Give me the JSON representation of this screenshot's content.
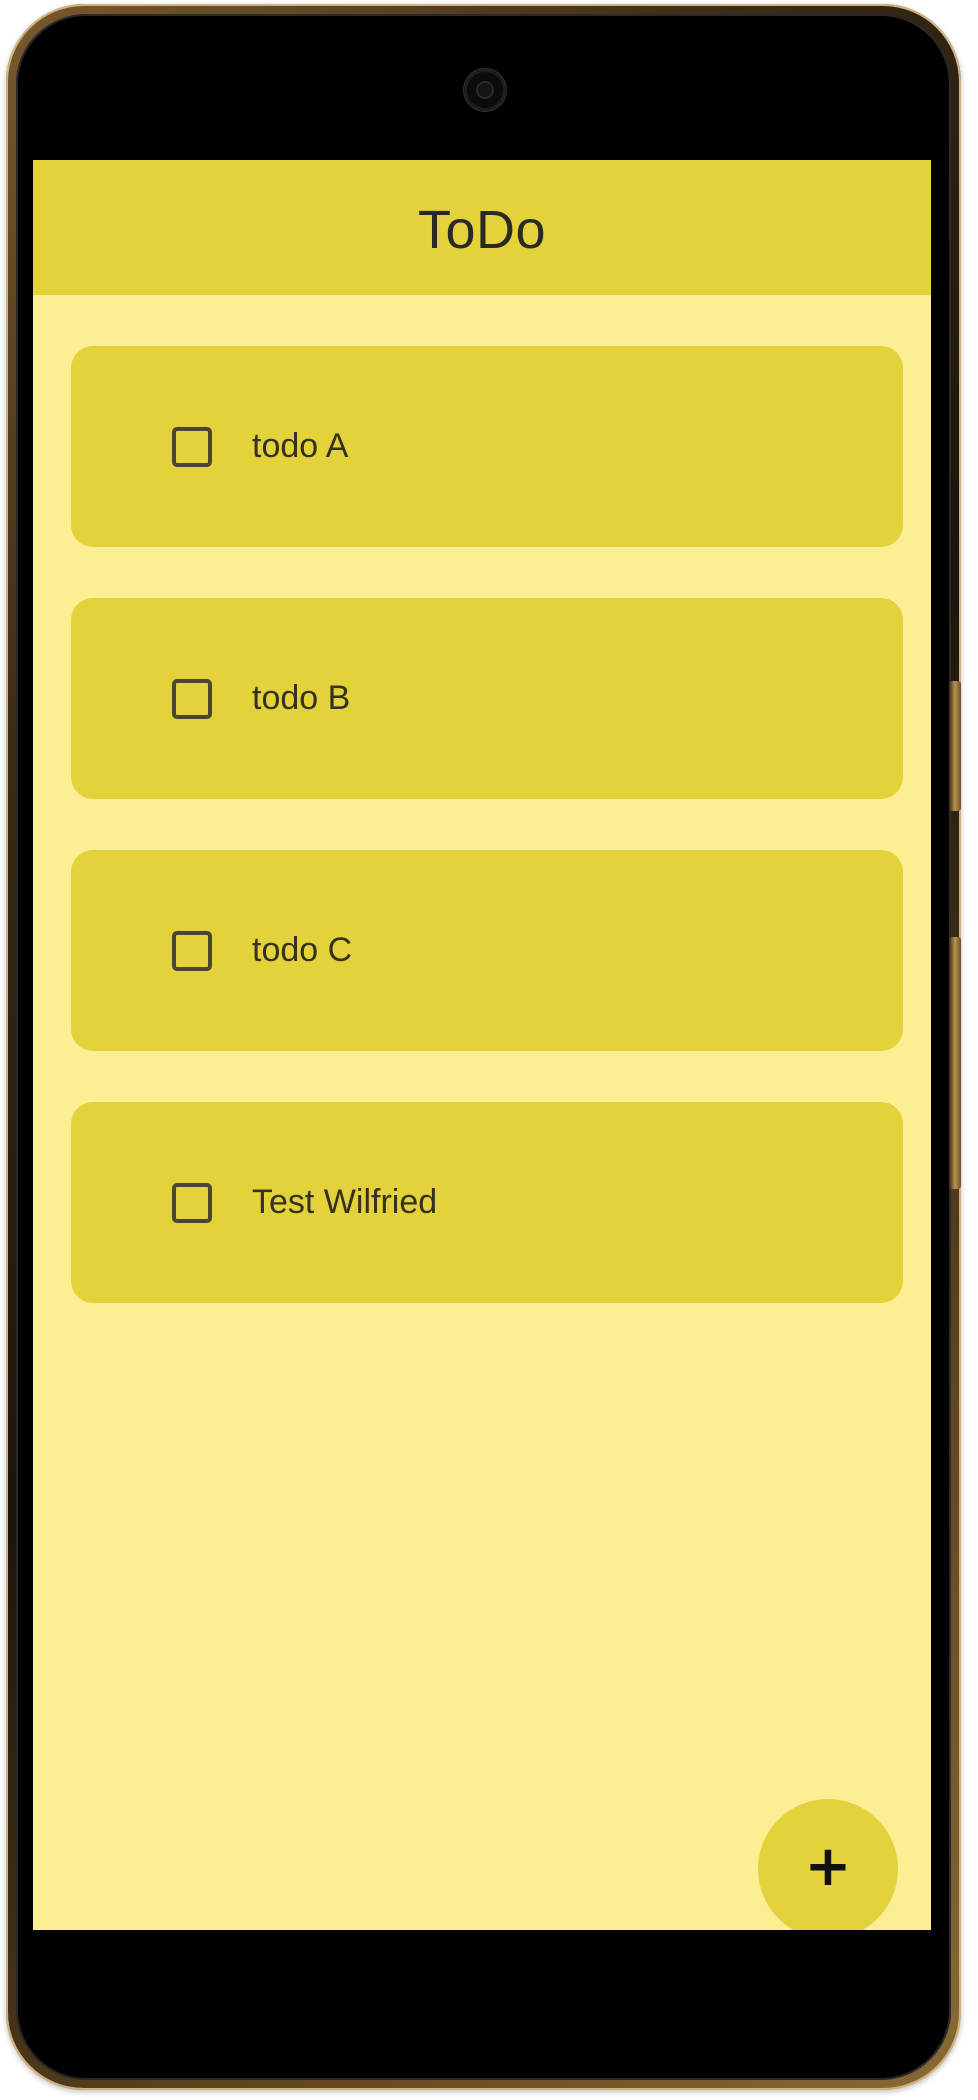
{
  "app": {
    "title": "ToDo"
  },
  "todos": [
    {
      "label": "todo A",
      "checked": false
    },
    {
      "label": "todo B",
      "checked": false
    },
    {
      "label": "todo C",
      "checked": false
    },
    {
      "label": "Test Wilfried",
      "checked": false
    }
  ],
  "fab": {
    "icon": "plus-icon",
    "symbol": "+"
  },
  "colors": {
    "app_bar": "#e4d23a",
    "background": "#fbee93",
    "card": "#e4d23a",
    "text": "#34321f"
  }
}
